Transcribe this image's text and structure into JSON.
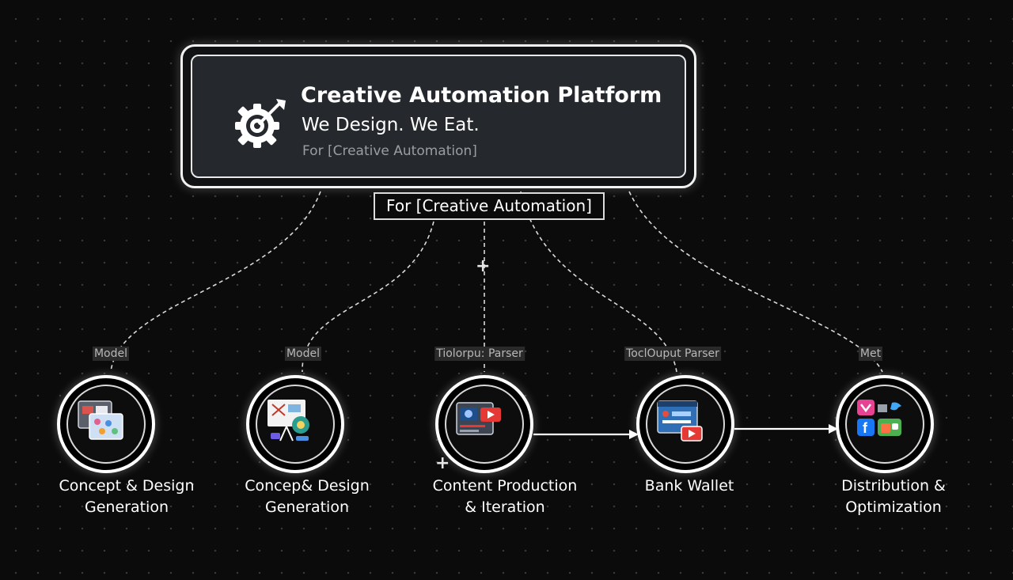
{
  "header": {
    "title": "Creative Automation Platform",
    "subtitle": "We Design. We Eat.",
    "tag": "For [Creative Automation]",
    "icon": "gear-target-icon"
  },
  "hub_label": "For [Creative Automation]",
  "connector_labels": [
    "Model",
    "Model",
    "Tiolorpu: Parser",
    "ToclOuput Parser",
    "Met"
  ],
  "nodes": [
    {
      "label_line1": "Concept & Design",
      "label_line2": "Generation",
      "icon": "design-windows-icon"
    },
    {
      "label_line1": "Concep& Design",
      "label_line2": "Generation",
      "icon": "presentation-board-icon"
    },
    {
      "label_line1": "Content Production",
      "label_line2": "& Iteration",
      "icon": "video-player-icon"
    },
    {
      "label_line1": "Bank Wallet",
      "label_line2": "",
      "icon": "browser-video-icon"
    },
    {
      "label_line1": "Distribution &",
      "label_line2": "Optimization",
      "icon": "social-apps-icon"
    }
  ],
  "colors": {
    "background": "#0b0b0b",
    "card": "#25282d",
    "stroke": "#ffffff",
    "label_chip": "#2a2a2a"
  }
}
